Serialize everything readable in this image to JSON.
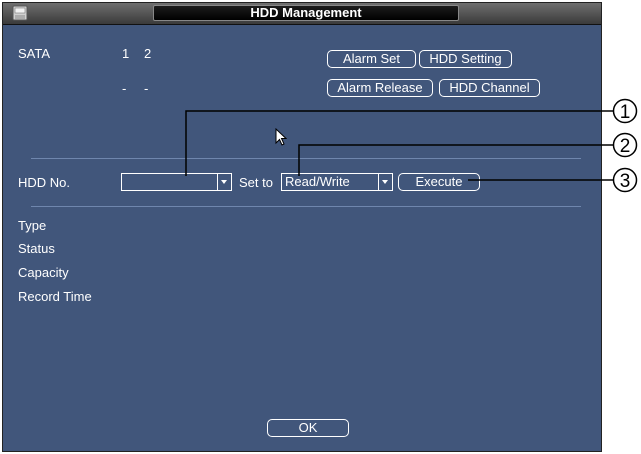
{
  "window": {
    "title": "HDD Management"
  },
  "sata": {
    "label": "SATA",
    "ports": [
      "1",
      "2"
    ],
    "states": [
      "-",
      "-"
    ]
  },
  "buttons": {
    "alarm_set": "Alarm Set",
    "hdd_setting": "HDD Setting",
    "alarm_release": "Alarm Release",
    "hdd_channel": "HDD Channel",
    "execute": "Execute",
    "ok": "OK"
  },
  "controls": {
    "hdd_no_label": "HDD No.",
    "hdd_no_value": "",
    "set_to_label": "Set to",
    "set_to_value": "Read/Write"
  },
  "info": {
    "type": "Type",
    "status": "Status",
    "capacity": "Capacity",
    "record_time": "Record Time"
  },
  "callouts": [
    "1",
    "2",
    "3"
  ],
  "colors": {
    "panel_bg": "#41567b",
    "text": "#ffffff",
    "separator": "#6f86ad"
  }
}
